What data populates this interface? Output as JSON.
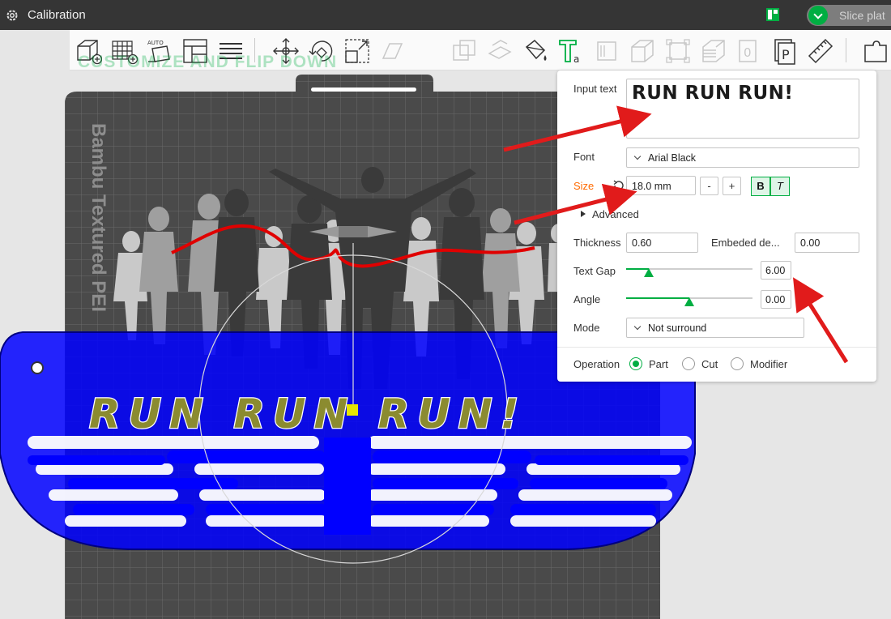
{
  "titlebar": {
    "title": "Calibration",
    "slice_button_label": "Slice plat"
  },
  "toolbar": {
    "watermark": "CUSTOMIZE AND FLIP DOWN"
  },
  "plate": {
    "label": "Bambu Textured PEI",
    "embossed_text": "RUN RUN RUN!"
  },
  "text_panel": {
    "input_text_label": "Input text",
    "input_text_value": "RUN RUN RUN!",
    "font_label": "Font",
    "font_value": "Arial Black",
    "size_label": "Size",
    "size_value": "18.0 mm",
    "minus_label": "-",
    "plus_label": "+",
    "bold_label": "B",
    "italic_label": "T",
    "advanced_label": "Advanced",
    "thickness_label": "Thickness",
    "thickness_value": "0.60",
    "embeded_label": "Embeded de...",
    "embeded_value": "0.00",
    "text_gap_label": "Text Gap",
    "text_gap_value": "6.00",
    "text_gap_level": 0.18,
    "angle_label": "Angle",
    "angle_value": "0.00",
    "angle_level": 0.5,
    "mode_label": "Mode",
    "mode_value": "Not surround",
    "operation_label": "Operation",
    "operations": [
      "Part",
      "Cut",
      "Modifier"
    ],
    "operation_selected": "Part"
  },
  "colors": {
    "accent": "#00ae42",
    "size_label": "#ff6a00",
    "annotation_arrow": "#e11b1b",
    "medal_blue": "#0000ff",
    "text_fill": "#8b8b30"
  }
}
